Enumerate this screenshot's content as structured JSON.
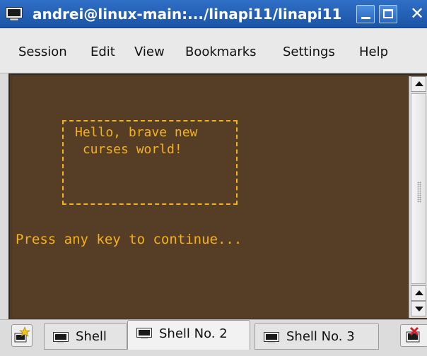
{
  "window": {
    "title": "andrei@linux-main:.../linapi11/linapi11",
    "app_icon": "terminal-icon",
    "buttons": [
      "minimize-icon",
      "maximize-icon",
      "close-icon"
    ]
  },
  "menubar": {
    "items": [
      "Session",
      "Edit",
      "View",
      "Bookmarks",
      "Settings",
      "Help"
    ]
  },
  "terminal": {
    "box_line_1": "Hello, brave new",
    "box_line_2": " curses world!",
    "prompt": "Press any key to continue...",
    "colors": {
      "background": "#553d26",
      "foreground": "#f5b21b"
    }
  },
  "tabbar": {
    "tabs": [
      {
        "label": "Shell",
        "active": false
      },
      {
        "label": "Shell No. 2",
        "active": true
      },
      {
        "label": "Shell No. 3",
        "active": false
      }
    ],
    "new_tab_icon": "new-tab-icon",
    "close_tab_icon": "close-tab-icon"
  }
}
